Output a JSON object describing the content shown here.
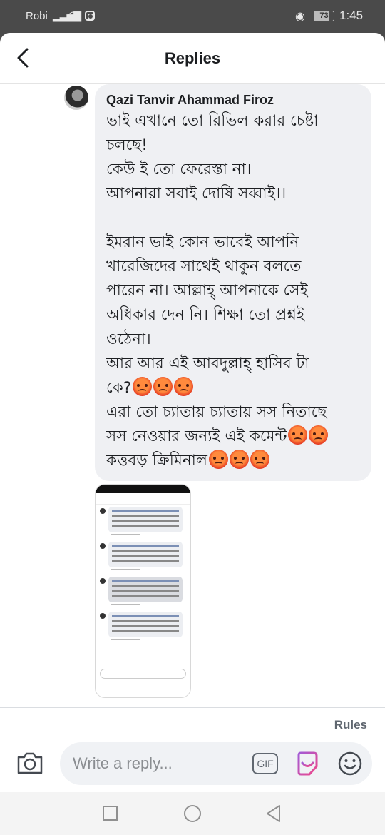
{
  "status_bar": {
    "carrier": "Robi",
    "battery": "73",
    "battery_level": 0.73,
    "time": "1:45",
    "icons": [
      "signal-icon",
      "wifi-icon",
      "instagram-icon",
      "eye-comfort-icon",
      "battery-icon"
    ]
  },
  "header": {
    "title": "Replies",
    "back_icon": "chevron-left-icon"
  },
  "comment": {
    "author": "Qazi Tanvir Ahammad Firoz",
    "lines": [
      "ভাই এখানে তো রিভিল করার চেষ্টা",
      "চলছে!",
      "কেউ ই তো ফেরেস্তা না।",
      "আপনারা সবাই দোষি সব্বাই।।",
      "",
      "ইমরান ভাই কোন ভাবেই আপনি",
      "খারেজিদের সাথেই থাকুন বলতে",
      "পারেন না। আল্লাহ্ আপনাকে সেই",
      "অধিকার দেন নি। শিক্ষা তো প্রশ্নই",
      "ওঠেনা।",
      "আর আর এই আবদুল্লাহ্ হাসিব টা",
      "কে?",
      "এরা তো চ্যাতায় চ্যাতায়  সস নিতাছে",
      "সস নেওয়ার জন্যই এই কমেন্ট",
      "কত্তবড় ক্রিমিনাল"
    ],
    "emoji": "angry-face-icon",
    "emoji_counts": [
      0,
      0,
      0,
      0,
      0,
      0,
      0,
      0,
      0,
      0,
      0,
      3,
      0,
      2,
      3
    ]
  },
  "attachment": {
    "type": "screenshot-image"
  },
  "rules_link": "Rules",
  "composer": {
    "placeholder": "Write a reply...",
    "gif_label": "GIF",
    "icons": [
      "camera-icon",
      "gif-icon",
      "sticker-icon",
      "emoji-icon"
    ]
  },
  "nav_bar": {
    "icons": [
      "recent-apps-icon",
      "home-icon",
      "back-icon"
    ]
  }
}
